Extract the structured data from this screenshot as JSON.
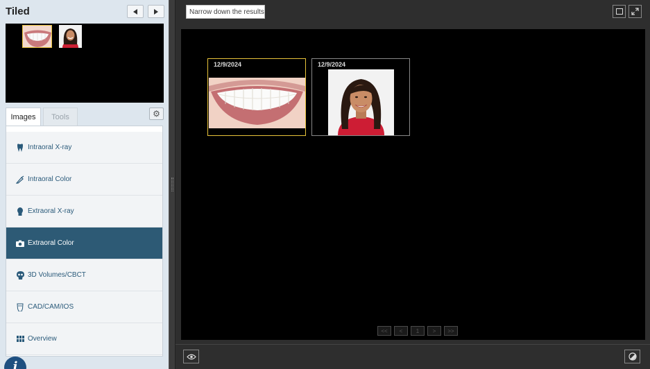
{
  "left_panel": {
    "title": "Tiled",
    "tabs": [
      {
        "label": "Images",
        "active": true
      },
      {
        "label": "Tools",
        "active": false
      }
    ],
    "categories": [
      {
        "label": "Intraoral X-ray",
        "icon": "tooth-icon",
        "active": false
      },
      {
        "label": "Intraoral Color",
        "icon": "brush-icon",
        "active": false
      },
      {
        "label": "Extraoral X-ray",
        "icon": "head-silhouette-icon",
        "active": false
      },
      {
        "label": "Extraoral Color",
        "icon": "camera-icon",
        "active": true
      },
      {
        "label": "3D Volumes/CBCT",
        "icon": "skull-icon",
        "active": false
      },
      {
        "label": "CAD/CAM/IOS",
        "icon": "crown-icon",
        "active": false
      },
      {
        "label": "Overview",
        "icon": "grid-icon",
        "active": false
      }
    ],
    "info_glyph": "i"
  },
  "right_panel": {
    "filter_placeholder": "Narrow down the results",
    "images": [
      {
        "date": "12/9/2024",
        "subject": "smile",
        "selected": true
      },
      {
        "date": "12/9/2024",
        "subject": "portrait",
        "selected": false
      }
    ],
    "pager": [
      {
        "label": "<<",
        "icon": "first-page-icon"
      },
      {
        "label": "<",
        "icon": "prev-page-icon"
      },
      {
        "label": "1",
        "icon": "page-number"
      },
      {
        "label": ">",
        "icon": "next-page-icon"
      },
      {
        "label": ">>",
        "icon": "last-page-icon"
      }
    ]
  },
  "colors": {
    "accent": "#2d5a75",
    "selection": "#e8c33a",
    "info_badge": "#1e4f80"
  }
}
